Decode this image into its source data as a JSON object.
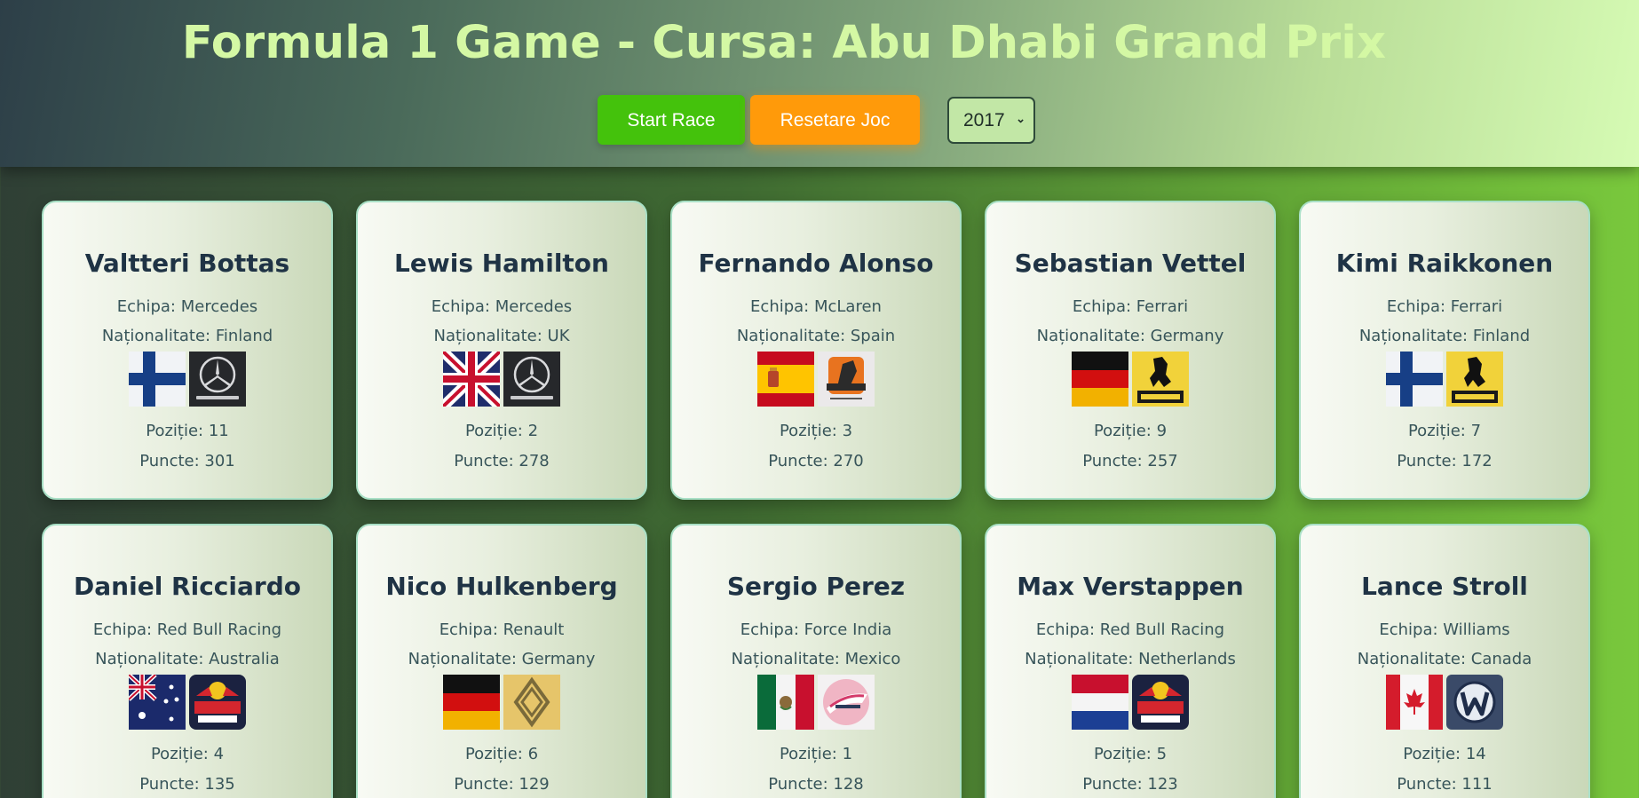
{
  "header": {
    "title": "Formula 1 Game - Cursa: Abu Dhabi Grand Prix",
    "start_label": "Start Race",
    "reset_label": "Resetare Joc",
    "year_selected": "2017"
  },
  "colors": {
    "start_button": "#44c20c",
    "reset_button": "#ff9a0a",
    "title_text": "#d4f8a4"
  },
  "drivers": [
    {
      "name": "Valtteri Bottas",
      "team": "Echipa: Mercedes",
      "nationality": "Naționalitate: Finland",
      "position": "Poziție: 11",
      "points": "Puncte: 301",
      "flag_icon": "finland-flag-icon",
      "team_icon": "mercedes-logo-icon"
    },
    {
      "name": "Lewis Hamilton",
      "team": "Echipa: Mercedes",
      "nationality": "Naționalitate: UK",
      "position": "Poziție: 2",
      "points": "Puncte: 278",
      "flag_icon": "uk-flag-icon",
      "team_icon": "mercedes-logo-icon"
    },
    {
      "name": "Fernando Alonso",
      "team": "Echipa: McLaren",
      "nationality": "Naționalitate: Spain",
      "position": "Poziție: 3",
      "points": "Puncte: 270",
      "flag_icon": "spain-flag-icon",
      "team_icon": "mclaren-logo-icon"
    },
    {
      "name": "Sebastian Vettel",
      "team": "Echipa: Ferrari",
      "nationality": "Naționalitate: Germany",
      "position": "Poziție: 9",
      "points": "Puncte: 257",
      "flag_icon": "germany-flag-icon",
      "team_icon": "ferrari-logo-icon"
    },
    {
      "name": "Kimi Raikkonen",
      "team": "Echipa: Ferrari",
      "nationality": "Naționalitate: Finland",
      "position": "Poziție: 7",
      "points": "Puncte: 172",
      "flag_icon": "finland-flag-icon",
      "team_icon": "ferrari-logo-icon"
    },
    {
      "name": "Daniel Ricciardo",
      "team": "Echipa: Red Bull Racing",
      "nationality": "Naționalitate: Australia",
      "position": "Poziție: 4",
      "points": "Puncte: 135",
      "flag_icon": "australia-flag-icon",
      "team_icon": "redbull-logo-icon"
    },
    {
      "name": "Nico Hulkenberg",
      "team": "Echipa: Renault",
      "nationality": "Naționalitate: Germany",
      "position": "Poziție: 6",
      "points": "Puncte: 129",
      "flag_icon": "germany-flag-icon",
      "team_icon": "renault-logo-icon"
    },
    {
      "name": "Sergio Perez",
      "team": "Echipa: Force India",
      "nationality": "Naționalitate: Mexico",
      "position": "Poziție: 1",
      "points": "Puncte: 128",
      "flag_icon": "mexico-flag-icon",
      "team_icon": "forceindia-logo-icon"
    },
    {
      "name": "Max Verstappen",
      "team": "Echipa: Red Bull Racing",
      "nationality": "Naționalitate: Netherlands",
      "position": "Poziție: 5",
      "points": "Puncte: 123",
      "flag_icon": "netherlands-flag-icon",
      "team_icon": "redbull-logo-icon"
    },
    {
      "name": "Lance Stroll",
      "team": "Echipa: Williams",
      "nationality": "Naționalitate: Canada",
      "position": "Poziție: 14",
      "points": "Puncte: 111",
      "flag_icon": "canada-flag-icon",
      "team_icon": "williams-logo-icon"
    }
  ]
}
